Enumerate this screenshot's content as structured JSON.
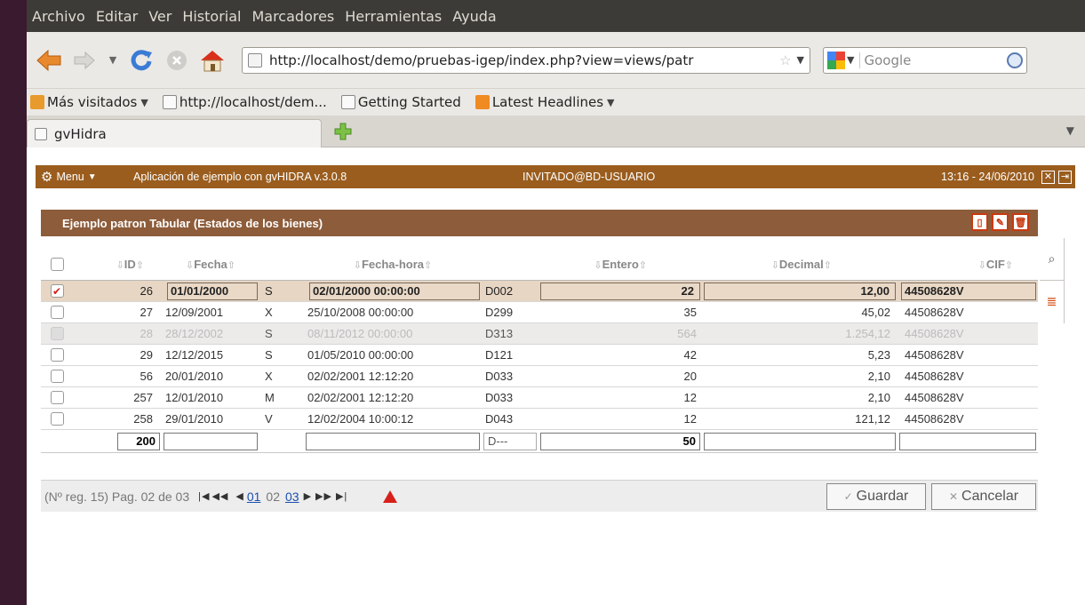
{
  "menubar": [
    "Archivo",
    "Editar",
    "Ver",
    "Historial",
    "Marcadores",
    "Herramientas",
    "Ayuda"
  ],
  "url": "http://localhost/demo/pruebas-igep/index.php?view=views/patr",
  "search_placeholder": "Google",
  "bookmarks": [
    "Más visitados",
    "http://localhost/dem...",
    "Getting Started",
    "Latest Headlines"
  ],
  "tab_title": "gvHidra",
  "app": {
    "menu_label": "Menu",
    "title": "Aplicación de ejemplo con gvHIDRA  v.3.0.8",
    "user": "INVITADO@BD-USUARIO",
    "datetime": "13:16 - 24/06/2010"
  },
  "panel_title": "Ejemplo patron Tabular (Estados de los bienes)",
  "columns": [
    "ID",
    "Fecha",
    "",
    "Fecha-hora",
    "",
    "Entero",
    "Decimal",
    "CIF"
  ],
  "rows": [
    {
      "checked": true,
      "id": "26",
      "fecha": "01/01/2000",
      "s": "S",
      "fechahora": "02/01/2000 00:00:00",
      "code": "D002",
      "entero": "22",
      "decimal": "12,00",
      "cif": "44508628V"
    },
    {
      "checked": false,
      "id": "27",
      "fecha": "12/09/2001",
      "s": "X",
      "fechahora": "25/10/2008 00:00:00",
      "code": "D299",
      "entero": "35",
      "decimal": "45,02",
      "cif": "44508628V"
    },
    {
      "checked": false,
      "id": "28",
      "fecha": "28/12/2002",
      "s": "S",
      "fechahora": "08/11/2012 00:00:00",
      "code": "D313",
      "entero": "564",
      "decimal": "1.254,12",
      "cif": "44508628V"
    },
    {
      "checked": false,
      "id": "29",
      "fecha": "12/12/2015",
      "s": "S",
      "fechahora": "01/05/2010 00:00:00",
      "code": "D121",
      "entero": "42",
      "decimal": "5,23",
      "cif": "44508628V"
    },
    {
      "checked": false,
      "id": "56",
      "fecha": "20/01/2010",
      "s": "X",
      "fechahora": "02/02/2001 12:12:20",
      "code": "D033",
      "entero": "20",
      "decimal": "2,10",
      "cif": "44508628V"
    },
    {
      "checked": false,
      "id": "257",
      "fecha": "12/01/2010",
      "s": "M",
      "fechahora": "02/02/2001 12:12:20",
      "code": "D033",
      "entero": "12",
      "decimal": "2,10",
      "cif": "44508628V"
    },
    {
      "checked": false,
      "id": "258",
      "fecha": "29/01/2010",
      "s": "V",
      "fechahora": "12/02/2004 10:00:12",
      "code": "D043",
      "entero": "12",
      "decimal": "121,12",
      "cif": "44508628V"
    }
  ],
  "new_row": {
    "id": "200",
    "code": "D---",
    "entero": "50"
  },
  "pager": {
    "info": "(Nº reg. 15) Pag. 02 de 03",
    "p1": "01",
    "p2": "02",
    "p3": "03"
  },
  "buttons": {
    "save": "Guardar",
    "cancel": "Cancelar"
  },
  "colors": {
    "app_bar": "#9a5d1e",
    "panel_header": "#8d5c3a",
    "selected_row": "#e7d6c4",
    "accent_red": "#c83a10"
  }
}
